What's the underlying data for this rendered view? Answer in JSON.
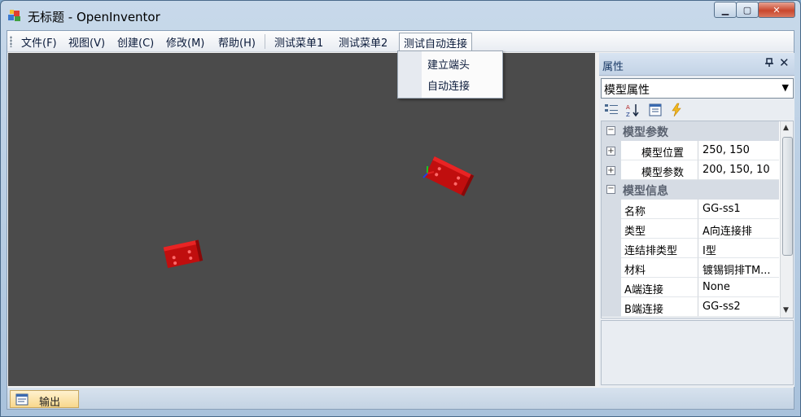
{
  "window": {
    "title": "无标题 - OpenInventor",
    "minimize_glyph": "▁",
    "maximize_glyph": "▢",
    "close_glyph": "✕"
  },
  "menubar": {
    "items": [
      "文件(F)",
      "视图(V)",
      "创建(C)",
      "修改(M)",
      "帮助(H)",
      "测试菜单1",
      "测试菜单2",
      "测试自动连接"
    ]
  },
  "dropdown": {
    "items": [
      "建立端头",
      "自动连接"
    ]
  },
  "properties": {
    "title": "属性",
    "pin_glyph": "📌",
    "close_glyph": "✕",
    "combo_value": "模型属性",
    "categories": [
      {
        "label": "模型参数",
        "toggle": "−"
      },
      {
        "label": "模型信息",
        "toggle": "−"
      }
    ],
    "rows": [
      {
        "name": "模型位置",
        "value": "250, 150",
        "expander": "+"
      },
      {
        "name": "模型参数",
        "value": "200, 150, 10",
        "expander": "+"
      },
      {
        "name": "名称",
        "value": "GG-ss1"
      },
      {
        "name": "类型",
        "value": "A向连接排"
      },
      {
        "name": "连结排类型",
        "value": "I型"
      },
      {
        "name": "材料",
        "value": "镀锡铜排TM..."
      },
      {
        "name": "A端连接",
        "value": "None"
      },
      {
        "name": "B端连接",
        "value": "GG-ss2"
      }
    ]
  },
  "output": {
    "tab_label": "输出"
  },
  "colors": {
    "viewport_bg": "#4b4b4b",
    "model_red": "#d01010"
  }
}
